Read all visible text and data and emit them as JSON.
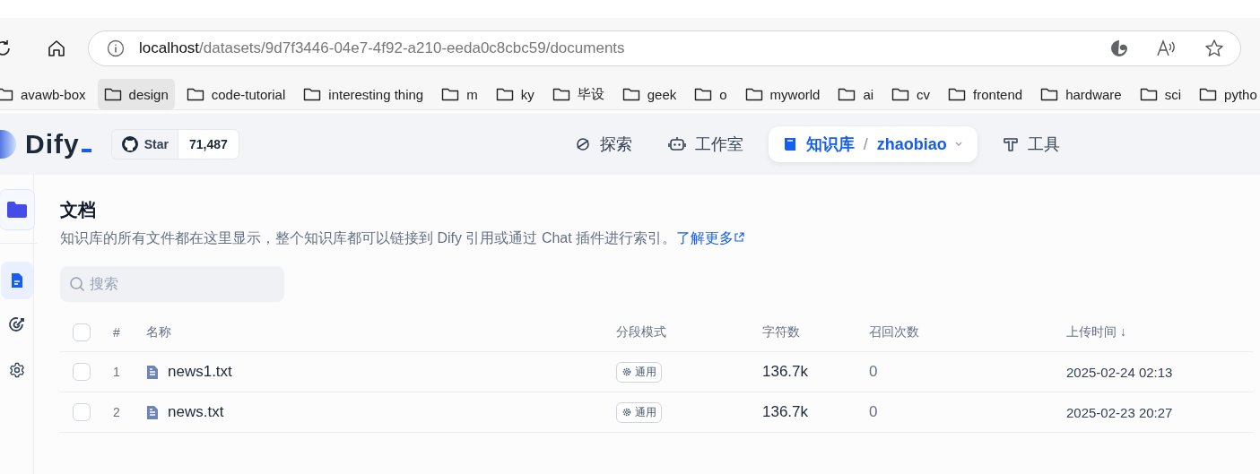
{
  "browser": {
    "address": {
      "host": "localhost",
      "path": "/datasets/9d7f3446-04e7-4f92-a210-eeda0c8cbc59/documents"
    },
    "bookmarks": [
      {
        "label": "avawb-box",
        "selected": false
      },
      {
        "label": "design",
        "selected": true
      },
      {
        "label": "code-tutorial",
        "selected": false
      },
      {
        "label": "interesting thing",
        "selected": false
      },
      {
        "label": "m",
        "selected": false
      },
      {
        "label": "ky",
        "selected": false
      },
      {
        "label": "毕设",
        "selected": false
      },
      {
        "label": "geek",
        "selected": false
      },
      {
        "label": "o",
        "selected": false
      },
      {
        "label": "myworld",
        "selected": false
      },
      {
        "label": "ai",
        "selected": false
      },
      {
        "label": "cv",
        "selected": false
      },
      {
        "label": "frontend",
        "selected": false
      },
      {
        "label": "hardware",
        "selected": false
      },
      {
        "label": "sci",
        "selected": false
      },
      {
        "label": "pytho",
        "selected": false
      }
    ]
  },
  "app": {
    "logo": "Dify",
    "github": {
      "label": "Star",
      "count": "71,487"
    },
    "nav": [
      {
        "label": "探索",
        "selected": false
      },
      {
        "label": "工作室",
        "selected": false
      },
      {
        "label": "知识库",
        "selected": true,
        "separator": "/",
        "dataset": "zhaobiao"
      },
      {
        "label": "工具",
        "selected": false
      }
    ]
  },
  "sidebar": {
    "items": [
      {
        "selected": true
      },
      {
        "selected": false
      },
      {
        "selected": false
      }
    ]
  },
  "page": {
    "title": "文档",
    "description": "知识库的所有文件都在这里显示，整个知识库都可以链接到 Dify 引用或通过 Chat 插件进行索引。",
    "learn_more": "了解更多",
    "search": {
      "placeholder": "搜索"
    },
    "table": {
      "all_checked": false,
      "columns": [
        "#",
        "名称",
        "分段模式",
        "字符数",
        "召回次数",
        "上传时间 ↓"
      ],
      "rows": [
        {
          "checked": false,
          "index": "1",
          "name": "news1.txt",
          "mode": "通用",
          "chars": "136.7k",
          "recalls": "0",
          "uploaded": "2025-02-24 02:13"
        },
        {
          "checked": false,
          "index": "2",
          "name": "news.txt",
          "mode": "通用",
          "chars": "136.7k",
          "recalls": "0",
          "uploaded": "2025-02-23 20:27"
        }
      ]
    }
  }
}
